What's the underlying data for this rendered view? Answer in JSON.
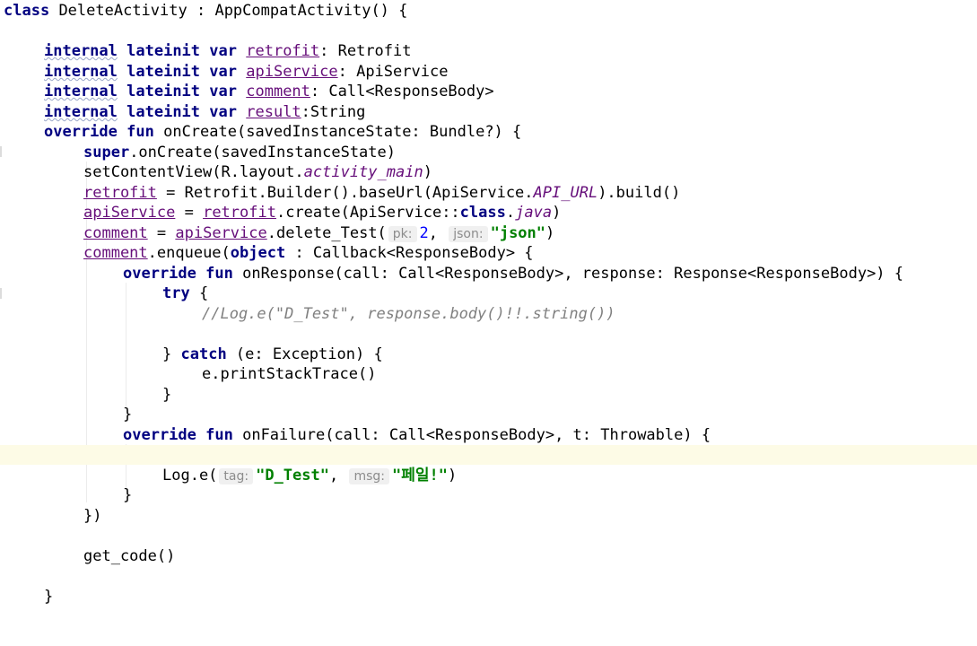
{
  "code": {
    "class_kw": "class",
    "class_name": "DeleteActivity",
    "class_sep": " : ",
    "class_super": "AppCompatActivity() {",
    "internal": "internal",
    "lateinit": "lateinit",
    "var": "var",
    "retrofit": "retrofit",
    "retrofit_type": ": Retrofit",
    "apiService": "apiService",
    "apiService_type": ": ApiService",
    "comment": "comment",
    "comment_type": ": Call<ResponseBody>",
    "result": "result",
    "result_type": ":String",
    "override": "override",
    "fun": "fun",
    "oncreate_sig": " onCreate(savedInstanceState: Bundle?) {",
    "super_kw": "super",
    "super_call": ".onCreate(savedInstanceState)",
    "setcontent_a": "setContentView(R.layout.",
    "activity_main": "activity_main",
    "setcontent_b": ")",
    "retrofit_assign": " = Retrofit.Builder().baseUrl(ApiService.",
    "api_url": "API_URL",
    "retrofit_build": ").build()",
    "eq_plain": " = ",
    "create_a": ".create(ApiService::",
    "class_lit": "class",
    "dot": ".",
    "java": "java",
    "create_b": ")",
    "delete_call": ".delete_Test(",
    "pk_hint": "pk:",
    "pk_value": "2",
    "comma": ", ",
    "json_hint": "json:",
    "json_value": "\"json\"",
    "close_paren": ")",
    "enqueue_a": ".enqueue(",
    "object_kw": "object",
    "enqueue_b": " : Callback<ResponseBody> {",
    "onresponse_sig": " onResponse(call: Call<ResponseBody>, response: Response<ResponseBody>) {",
    "try_kw": "try",
    "brace_open": " {",
    "log_comment": "//Log.e(\"D_Test\", response.body()!!.string())",
    "close_brace": "}",
    "catch_kw": "catch",
    "catch_sig": " (e: Exception) {",
    "print_stack": "e.printStackTrace()",
    "onfailure_sig": " onFailure(call: Call<ResponseBody>, t: Throwable) {",
    "log_e": "Log.e(",
    "tag_hint": "tag:",
    "tag_value": "\"D_Test\"",
    "comma2": ",",
    "msg_hint": "msg:",
    "msg_value": "\"페일!\"",
    "close_obj": "})",
    "get_code": "get_code()"
  }
}
